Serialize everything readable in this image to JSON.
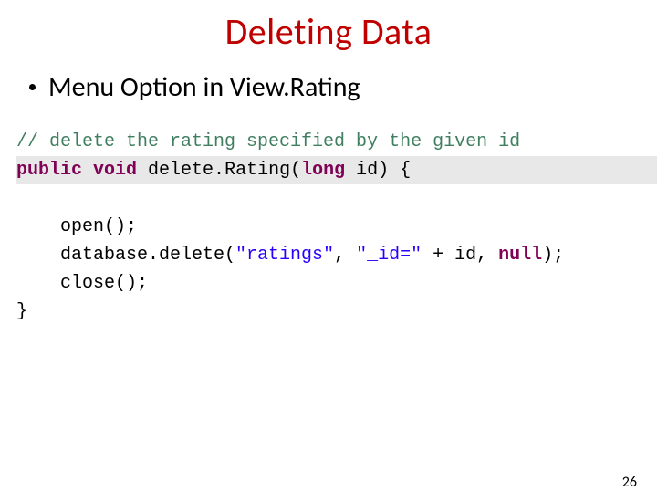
{
  "title": "Deleting Data",
  "bullet": "Menu Option in View.Rating",
  "code": {
    "comment": "// delete the rating specified by the given id",
    "kw_public": "public",
    "kw_void": "void",
    "method_name": " delete.Rating(",
    "kw_long": "long",
    "params_close": " id) {",
    "line_open": "    open();",
    "line_db_pre": "    database.delete(",
    "str_ratings": "\"ratings\"",
    "comma1": ", ",
    "str_idclause": "\"_id=\"",
    "db_post": " + id, ",
    "kw_null": "null",
    "db_close": ");",
    "line_close": "    close();",
    "brace_close": "}"
  },
  "page_number": "26"
}
